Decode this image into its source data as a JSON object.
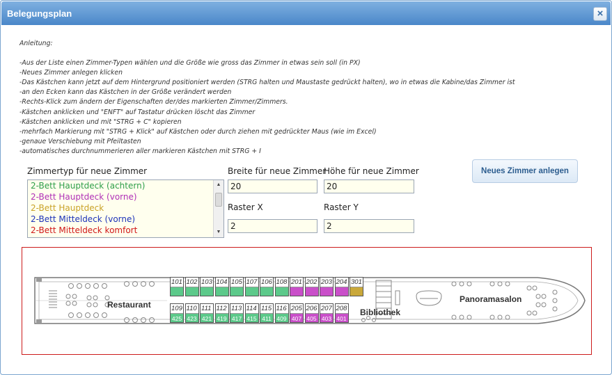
{
  "window": {
    "title": "Belegungsplan",
    "close_label": "×"
  },
  "instructions": {
    "heading": "Anleitung:",
    "lines": [
      "-Aus der Liste einen Zimmer-Typen wählen und die Größe wie gross das Zimmer in etwas sein soll (in PX)",
      "-Neues Zimmer anlegen klicken",
      "-Das Kästchen kann jetzt auf dem Hintergrund positioniert werden (STRG halten und Maustaste gedrückt halten), wo in etwas die Kabine/das Zimmer ist",
      "-an den Ecken kann das Kästchen in der Größe verändert werden",
      "-Rechts-Klick zum ändern der Eigenschaften der/des markierten Zimmer/Zimmers.",
      "-Kästchen anklicken und \"ENFT\" auf Tastatur drücken löscht das Zimmer",
      "-Kästchen anklicken und mit \"STRG + C\" kopieren",
      "-mehrfach Markierung mit \"STRG + Klick\" auf Kästchen oder durch ziehen mit gedrückter Maus (wie im Excel)",
      "-genaue Verschiebung mit Pfeiltasten",
      "-automatisches durchnummerieren aller markieren Kästchen mit STRG + I"
    ]
  },
  "form": {
    "room_type_label": "Zimmertyp für neue Zimmer",
    "room_types": [
      {
        "label": "2-Bett Hauptdeck (achtern)",
        "color": "#2e9e4a"
      },
      {
        "label": "2-Bett Hauptdeck (vorne)",
        "color": "#b02fb7"
      },
      {
        "label": "2-Bett Hauptdeck",
        "color": "#c9a227"
      },
      {
        "label": "2-Bett Mitteldeck (vorne)",
        "color": "#1d33b8"
      },
      {
        "label": "2-Bett Mitteldeck komfort",
        "color": "#d01818"
      }
    ],
    "width_label": "Breite für neue Zimmer",
    "width_value": "20",
    "height_label": "Höhe für neue Zimmer",
    "height_value": "20",
    "raster_x_label": "Raster X",
    "raster_x_value": "2",
    "raster_y_label": "Raster Y",
    "raster_y_value": "2",
    "create_button": "Neues Zimmer anlegen"
  },
  "deck_plan": {
    "labels": {
      "restaurant": "Restaurant",
      "library": "Bibliothek",
      "panorama": "Panoramasalon"
    },
    "colors": {
      "green": "#5cc98a",
      "purple": "#c94fc9",
      "gold": "#c9a83a"
    },
    "top_row": [
      {
        "num": "101",
        "sub": "",
        "color": "green"
      },
      {
        "num": "102",
        "sub": "",
        "color": "green"
      },
      {
        "num": "103",
        "sub": "",
        "color": "green"
      },
      {
        "num": "104",
        "sub": "",
        "color": "green"
      },
      {
        "num": "105",
        "sub": "",
        "color": "green"
      },
      {
        "num": "107",
        "sub": "",
        "color": "green"
      },
      {
        "num": "106",
        "sub": "",
        "color": "green"
      },
      {
        "num": "108",
        "sub": "",
        "color": "green"
      },
      {
        "num": "201",
        "sub": "",
        "color": "purple"
      },
      {
        "num": "202",
        "sub": "",
        "color": "purple"
      },
      {
        "num": "203",
        "sub": "",
        "color": "purple"
      },
      {
        "num": "204",
        "sub": "",
        "color": "purple"
      },
      {
        "num": "301",
        "sub": "",
        "color": "gold"
      }
    ],
    "bottom_row": [
      {
        "num": "109",
        "sub": "425",
        "color": "green"
      },
      {
        "num": "110",
        "sub": "423",
        "color": "green"
      },
      {
        "num": "111",
        "sub": "421",
        "color": "green"
      },
      {
        "num": "112",
        "sub": "419",
        "color": "green"
      },
      {
        "num": "113",
        "sub": "417",
        "color": "green"
      },
      {
        "num": "114",
        "sub": "415",
        "color": "green"
      },
      {
        "num": "115",
        "sub": "411",
        "color": "green"
      },
      {
        "num": "116",
        "sub": "409",
        "color": "green"
      },
      {
        "num": "205",
        "sub": "407",
        "color": "purple"
      },
      {
        "num": "206",
        "sub": "405",
        "color": "purple"
      },
      {
        "num": "207",
        "sub": "403",
        "color": "purple"
      },
      {
        "num": "208",
        "sub": "401",
        "color": "purple"
      }
    ]
  }
}
